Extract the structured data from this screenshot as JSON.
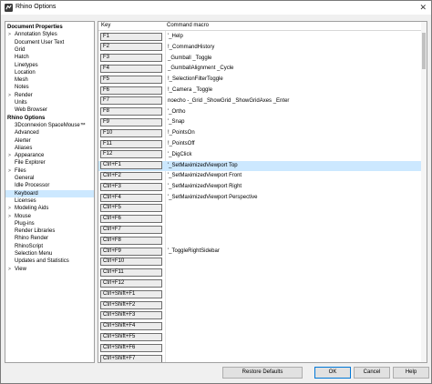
{
  "window": {
    "title": "Rhino Options",
    "close_glyph": "✕"
  },
  "tree": {
    "items": [
      {
        "label": "Document Properties",
        "level": 0,
        "category": true,
        "arrow": "",
        "selected": false
      },
      {
        "label": "Annotation Styles",
        "level": 1,
        "category": false,
        "arrow": ">",
        "selected": false
      },
      {
        "label": "Document User Text",
        "level": 1,
        "category": false,
        "arrow": "",
        "selected": false
      },
      {
        "label": "Grid",
        "level": 1,
        "category": false,
        "arrow": "",
        "selected": false
      },
      {
        "label": "Hatch",
        "level": 1,
        "category": false,
        "arrow": "",
        "selected": false
      },
      {
        "label": "Linetypes",
        "level": 1,
        "category": false,
        "arrow": "",
        "selected": false
      },
      {
        "label": "Location",
        "level": 1,
        "category": false,
        "arrow": "",
        "selected": false
      },
      {
        "label": "Mesh",
        "level": 1,
        "category": false,
        "arrow": "",
        "selected": false
      },
      {
        "label": "Notes",
        "level": 1,
        "category": false,
        "arrow": "",
        "selected": false
      },
      {
        "label": "Render",
        "level": 1,
        "category": false,
        "arrow": ">",
        "selected": false
      },
      {
        "label": "Units",
        "level": 1,
        "category": false,
        "arrow": "",
        "selected": false
      },
      {
        "label": "Web Browser",
        "level": 1,
        "category": false,
        "arrow": "",
        "selected": false
      },
      {
        "label": "Rhino Options",
        "level": 0,
        "category": true,
        "arrow": "",
        "selected": false
      },
      {
        "label": "3Dconnexion SpaceMouse™",
        "level": 1,
        "category": false,
        "arrow": "",
        "selected": false
      },
      {
        "label": "Advanced",
        "level": 1,
        "category": false,
        "arrow": "",
        "selected": false
      },
      {
        "label": "Alerter",
        "level": 1,
        "category": false,
        "arrow": "",
        "selected": false
      },
      {
        "label": "Aliases",
        "level": 1,
        "category": false,
        "arrow": "",
        "selected": false
      },
      {
        "label": "Appearance",
        "level": 1,
        "category": false,
        "arrow": ">",
        "selected": false
      },
      {
        "label": "File Explorer",
        "level": 1,
        "category": false,
        "arrow": "",
        "selected": false
      },
      {
        "label": "Files",
        "level": 1,
        "category": false,
        "arrow": ">",
        "selected": false
      },
      {
        "label": "General",
        "level": 1,
        "category": false,
        "arrow": "",
        "selected": false
      },
      {
        "label": "Idle Processor",
        "level": 1,
        "category": false,
        "arrow": "",
        "selected": false
      },
      {
        "label": "Keyboard",
        "level": 1,
        "category": false,
        "arrow": "",
        "selected": true
      },
      {
        "label": "Licenses",
        "level": 1,
        "category": false,
        "arrow": "",
        "selected": false
      },
      {
        "label": "Modeling Aids",
        "level": 1,
        "category": false,
        "arrow": ">",
        "selected": false
      },
      {
        "label": "Mouse",
        "level": 1,
        "category": false,
        "arrow": ">",
        "selected": false
      },
      {
        "label": "Plug-ins",
        "level": 1,
        "category": false,
        "arrow": "",
        "selected": false
      },
      {
        "label": "Render Libraries",
        "level": 1,
        "category": false,
        "arrow": "",
        "selected": false
      },
      {
        "label": "Rhino Render",
        "level": 1,
        "category": false,
        "arrow": "",
        "selected": false
      },
      {
        "label": "RhinoScript",
        "level": 1,
        "category": false,
        "arrow": "",
        "selected": false
      },
      {
        "label": "Selection Menu",
        "level": 1,
        "category": false,
        "arrow": "",
        "selected": false
      },
      {
        "label": "Updates and Statistics",
        "level": 1,
        "category": false,
        "arrow": "",
        "selected": false
      },
      {
        "label": "View",
        "level": 1,
        "category": false,
        "arrow": ">",
        "selected": false
      }
    ]
  },
  "grid": {
    "columns": {
      "key": "Key",
      "macro": "Command macro"
    },
    "rows": [
      {
        "key": "F1",
        "macro": "'_Help",
        "selected": false
      },
      {
        "key": "F2",
        "macro": "!_CommandHistory",
        "selected": false
      },
      {
        "key": "F3",
        "macro": "_Gumball _Toggle",
        "selected": false
      },
      {
        "key": "F4",
        "macro": "_GumballAlignment _Cycle",
        "selected": false
      },
      {
        "key": "F5",
        "macro": "!_SelectionFilterToggle",
        "selected": false
      },
      {
        "key": "F6",
        "macro": "!_Camera _Toggle",
        "selected": false
      },
      {
        "key": "F7",
        "macro": "noecho -_Grid _ShowGrid _ShowGridAxes _Enter",
        "selected": false
      },
      {
        "key": "F8",
        "macro": "'_Ortho",
        "selected": false
      },
      {
        "key": "F9",
        "macro": "'_Snap",
        "selected": false
      },
      {
        "key": "F10",
        "macro": "!_PointsOn",
        "selected": false
      },
      {
        "key": "F11",
        "macro": "!_PointsOff",
        "selected": false
      },
      {
        "key": "F12",
        "macro": "'_DigClick",
        "selected": false
      },
      {
        "key": "Ctrl+F1",
        "macro": "'_SetMaximizedViewport Top",
        "selected": true
      },
      {
        "key": "Ctrl+F2",
        "macro": "'_SetMaximizedViewport Front",
        "selected": false
      },
      {
        "key": "Ctrl+F3",
        "macro": "'_SetMaximizedViewport Right",
        "selected": false
      },
      {
        "key": "Ctrl+F4",
        "macro": "'_SetMaximizedViewport Perspective",
        "selected": false
      },
      {
        "key": "Ctrl+F5",
        "macro": "",
        "selected": false
      },
      {
        "key": "Ctrl+F6",
        "macro": "",
        "selected": false
      },
      {
        "key": "Ctrl+F7",
        "macro": "",
        "selected": false
      },
      {
        "key": "Ctrl+F8",
        "macro": "",
        "selected": false
      },
      {
        "key": "Ctrl+F9",
        "macro": "'_ToggleRightSidebar",
        "selected": false
      },
      {
        "key": "Ctrl+F10",
        "macro": "",
        "selected": false
      },
      {
        "key": "Ctrl+F11",
        "macro": "",
        "selected": false
      },
      {
        "key": "Ctrl+F12",
        "macro": "",
        "selected": false
      },
      {
        "key": "Ctrl+Shift+F1",
        "macro": "",
        "selected": false
      },
      {
        "key": "Ctrl+Shift+F2",
        "macro": "",
        "selected": false
      },
      {
        "key": "Ctrl+Shift+F3",
        "macro": "",
        "selected": false
      },
      {
        "key": "Ctrl+Shift+F4",
        "macro": "",
        "selected": false
      },
      {
        "key": "Ctrl+Shift+F5",
        "macro": "",
        "selected": false
      },
      {
        "key": "Ctrl+Shift+F6",
        "macro": "",
        "selected": false
      },
      {
        "key": "Ctrl+Shift+F7",
        "macro": "",
        "selected": false
      }
    ]
  },
  "buttons": {
    "restore_defaults": "Restore Defaults",
    "ok": "OK",
    "cancel": "Cancel",
    "help": "Help"
  },
  "colors": {
    "selection": "#cce8ff",
    "accent": "#0078d7"
  }
}
